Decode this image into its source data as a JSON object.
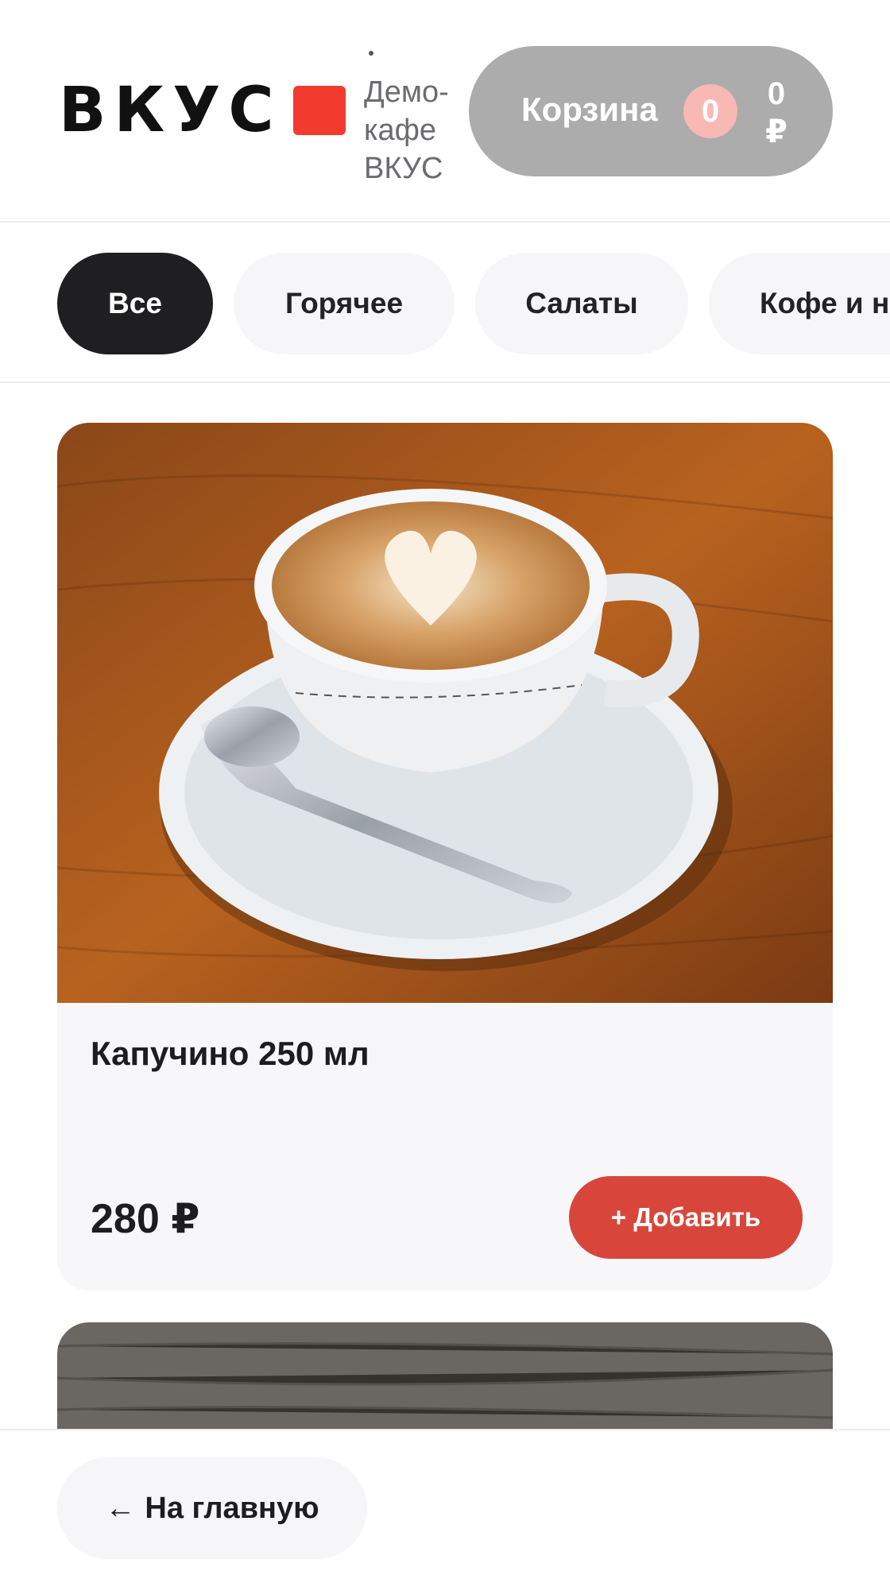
{
  "header": {
    "logo_text": "ВКУС",
    "cafe_name": "Демо-кафе ВКУС",
    "cart": {
      "label": "Корзина",
      "count": "0",
      "total": "0 ₽"
    }
  },
  "categories": [
    {
      "label": "Все",
      "active": true
    },
    {
      "label": "Горячее",
      "active": false
    },
    {
      "label": "Салаты",
      "active": false
    },
    {
      "label": "Кофе и н",
      "active": false
    }
  ],
  "products": [
    {
      "title": "Капучино 250 мл",
      "price": "280 ₽",
      "add_label": "+ Добавить",
      "image": "cappuccino-photo"
    }
  ],
  "footer": {
    "home_label": "На главную",
    "home_icon": "arrow-left-icon"
  },
  "colors": {
    "accent": "#d8463b",
    "brand_square": "#f23a2e",
    "cart_bg": "#acacac",
    "chip_active": "#1f1f21"
  }
}
